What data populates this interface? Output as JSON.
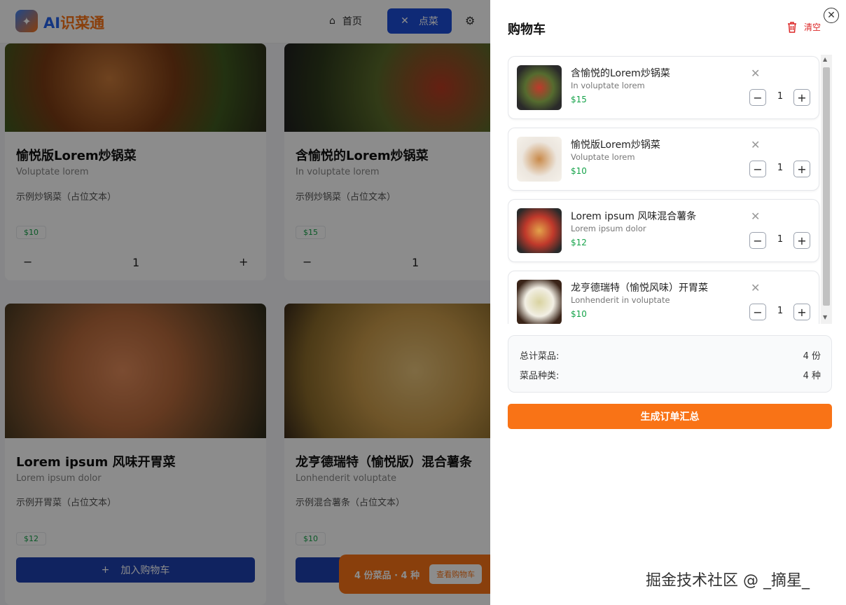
{
  "app": {
    "brand_ai": "AI",
    "brand_rest": "识菜通"
  },
  "nav": {
    "home": "首页",
    "order": "点菜"
  },
  "cards": [
    {
      "title": "愉悦版Lorem炒锅菜",
      "subtitle": "Voluptate lorem",
      "desc": "示例炒锅菜（占位文本）",
      "price": "$10",
      "qty": "1"
    },
    {
      "title": "含愉悦的Lorem炒锅菜",
      "subtitle": "In voluptate lorem",
      "desc": "示例炒锅菜（占位文本）",
      "price": "$15",
      "qty": "1"
    },
    {
      "title": "Lorem ipsum 风味开胃菜",
      "subtitle": "Lorem ipsum dolor",
      "desc": "示例开胃菜（占位文本）",
      "price": "$12",
      "add_label": "加入购物车"
    },
    {
      "title": "龙亨德瑞特（愉悦版）混合薯条",
      "subtitle": "Lonhenderit voluptate",
      "desc": "示例混合薯条（占位文本）",
      "price": "$10"
    }
  ],
  "floatbar": {
    "summary": "4 份菜品 · 4 种",
    "button": "查看购物车"
  },
  "cart": {
    "title": "购物车",
    "clear_label": "清空",
    "items": [
      {
        "name": "含愉悦的Lorem炒锅菜",
        "subtitle": "In voluptate lorem",
        "price": "$15",
        "qty": "1"
      },
      {
        "name": "愉悦版Lorem炒锅菜",
        "subtitle": "Voluptate lorem",
        "price": "$10",
        "qty": "1"
      },
      {
        "name": "Lorem ipsum 风味混合薯条",
        "subtitle": "Lorem ipsum dolor",
        "price": "$12",
        "qty": "1"
      },
      {
        "name": "龙亨德瑞特（愉悦风味）开胃菜",
        "subtitle": "Lonhenderit in voluptate",
        "price": "$10",
        "qty": "1"
      }
    ],
    "summary": {
      "total_label": "总计菜品:",
      "total_value": "4 份",
      "kinds_label": "菜品种类:",
      "kinds_value": "4 种"
    },
    "generate_button": "生成订单汇总"
  },
  "watermark": "掘金技术社区 @ _摘星_",
  "colors": {
    "primary": "#1d4ed8",
    "accent": "#f97316",
    "price": "#16a34a",
    "danger": "#dc2626"
  },
  "icons": [
    "logo-icon",
    "home-icon",
    "utensils-icon",
    "gear-icon",
    "trash-icon",
    "close-icon",
    "remove-icon",
    "minus-icon",
    "plus-icon"
  ]
}
